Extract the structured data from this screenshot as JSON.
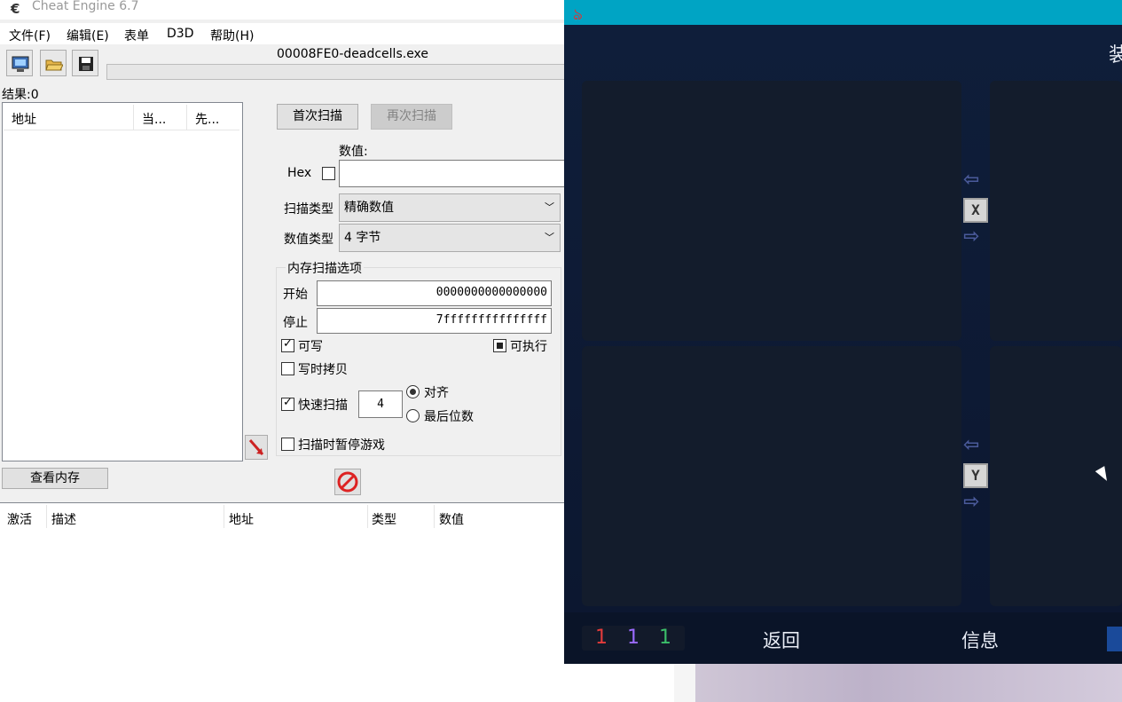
{
  "cheat_engine": {
    "title": "Cheat Engine 6.7",
    "menu": [
      "文件(F)",
      "编辑(E)",
      "表单",
      "D3D",
      "帮助(H)"
    ],
    "process": "00008FE0-deadcells.exe",
    "results": "结果:0",
    "found_list": {
      "columns": [
        "地址",
        "当...",
        "先..."
      ]
    },
    "first_scan": "首次扫描",
    "next_scan": "再次扫描",
    "value_label": "数值:",
    "hex_label": "Hex",
    "scan_type_label": "扫描类型",
    "scan_type_value": "精确数值",
    "value_type_label": "数值类型",
    "value_type_value": "4 字节",
    "memory_options": {
      "title": "内存扫描选项",
      "start_label": "开始",
      "start_value": "0000000000000000",
      "stop_label": "停止",
      "stop_value": "7fffffffffffffff",
      "writable": "可写",
      "executable": "可执行",
      "copy_on_write": "写时拷贝",
      "fast_scan": "快速扫描",
      "fast_scan_value": "4",
      "align": "对齐",
      "last_digits": "最后位数",
      "pause_game": "扫描时暂停游戏"
    },
    "view_memory": "查看内存",
    "address_list": {
      "columns": [
        "激活",
        "描述",
        "地址",
        "类型",
        "数值"
      ]
    }
  },
  "game": {
    "header_glyph": "装",
    "keys": [
      "X",
      "Y"
    ],
    "counters": [
      "1",
      "1",
      "1"
    ],
    "counter_colors": [
      "#e33b3b",
      "#9b6bff",
      "#3bbf6a"
    ],
    "back": "返回",
    "info": "信息"
  },
  "colors": {
    "game_titlebar": "#00a4c4",
    "game_bg": "#0d1a33"
  }
}
